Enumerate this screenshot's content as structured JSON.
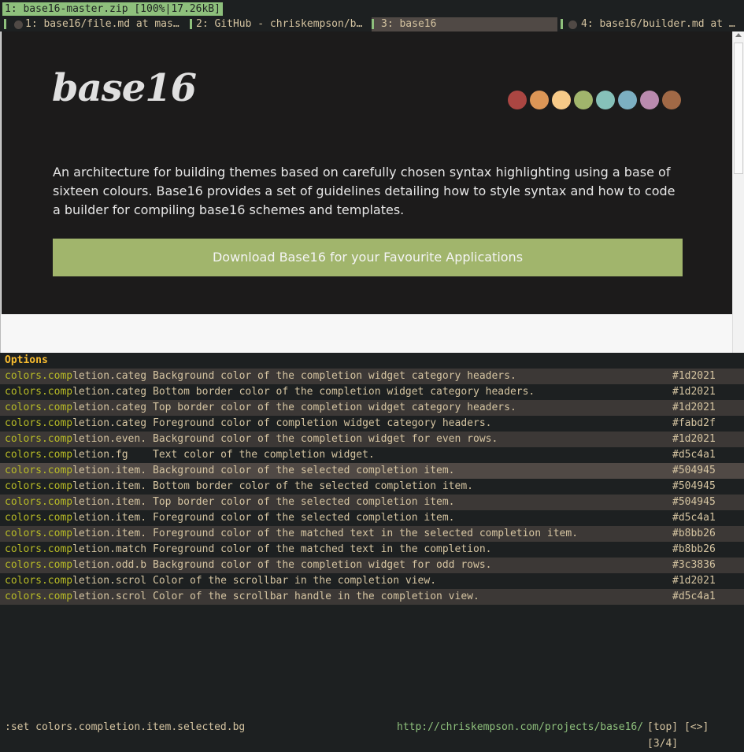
{
  "download": {
    "label": "1: base16-master.zip [100%|17.26kB]"
  },
  "tabs": [
    {
      "label": "1: base16/file.md at mas…"
    },
    {
      "label": "2: GitHub - chriskempson/b…"
    },
    {
      "label": "3: base16"
    },
    {
      "label": "4: base16/builder.md at …"
    }
  ],
  "page": {
    "logo": "base16",
    "swatch_colors": [
      "#ab4642",
      "#dc9656",
      "#f7ca88",
      "#a1b56c",
      "#86c1b9",
      "#7cafc2",
      "#ba8baf",
      "#a16946"
    ],
    "description": "An architecture for building themes based on carefully chosen syntax highlighting using a base of sixteen colours. Base16 provides a set of guidelines detailing how to style syntax and how to code a builder for compiling base16 schemes and templates.",
    "download_button": "Download Base16 for your Favourite Applications"
  },
  "completion": {
    "header": "Options",
    "match": "comp",
    "rows": [
      {
        "pre": "colors.",
        "match": "comp",
        "post": "letion.categ",
        "desc": "Background color of the completion widget category headers.",
        "value": "#1d2021"
      },
      {
        "pre": "colors.",
        "match": "comp",
        "post": "letion.categ",
        "desc": "Bottom border color of the completion widget category headers.",
        "value": "#1d2021"
      },
      {
        "pre": "colors.",
        "match": "comp",
        "post": "letion.categ",
        "desc": "Top border color of the completion widget category headers.",
        "value": "#1d2021"
      },
      {
        "pre": "colors.",
        "match": "comp",
        "post": "letion.categ",
        "desc": "Foreground color of completion widget category headers.",
        "value": "#fabd2f"
      },
      {
        "pre": "colors.",
        "match": "comp",
        "post": "letion.even.",
        "desc": "Background color of the completion widget for even rows.",
        "value": "#1d2021"
      },
      {
        "pre": "colors.",
        "match": "comp",
        "post": "letion.fg",
        "desc": "Text color of the completion widget.",
        "value": "#d5c4a1"
      },
      {
        "pre": "colors.",
        "match": "comp",
        "post": "letion.item.",
        "desc": "Background color of the selected completion item.",
        "value": "#504945"
      },
      {
        "pre": "colors.",
        "match": "comp",
        "post": "letion.item.",
        "desc": "Bottom border color of the selected completion item.",
        "value": "#504945"
      },
      {
        "pre": "colors.",
        "match": "comp",
        "post": "letion.item.",
        "desc": "Top border color of the selected completion item.",
        "value": "#504945"
      },
      {
        "pre": "colors.",
        "match": "comp",
        "post": "letion.item.",
        "desc": "Foreground color of the selected completion item.",
        "value": "#d5c4a1"
      },
      {
        "pre": "colors.",
        "match": "comp",
        "post": "letion.item.",
        "desc": "Foreground color of the matched text in the selected completion item.",
        "value": "#b8bb26"
      },
      {
        "pre": "colors.",
        "match": "comp",
        "post": "letion.match",
        "desc": "Foreground color of the matched text in the completion.",
        "value": "#b8bb26"
      },
      {
        "pre": "colors.",
        "match": "comp",
        "post": "letion.odd.b",
        "desc": "Background color of the completion widget for odd rows.",
        "value": "#3c3836"
      },
      {
        "pre": "colors.",
        "match": "comp",
        "post": "letion.scrol",
        "desc": "Color of the scrollbar in the completion view.",
        "value": "#1d2021"
      },
      {
        "pre": "colors.",
        "match": "comp",
        "post": "letion.scrol",
        "desc": "Color of the scrollbar handle in the completion view.",
        "value": "#d5c4a1"
      }
    ],
    "selected_index": 6
  },
  "statusbar": {
    "command": ":set colors.completion.item.selected.bg",
    "url": "http://chriskempson.com/projects/base16/",
    "position": "[top] [<>] [3/4]"
  }
}
